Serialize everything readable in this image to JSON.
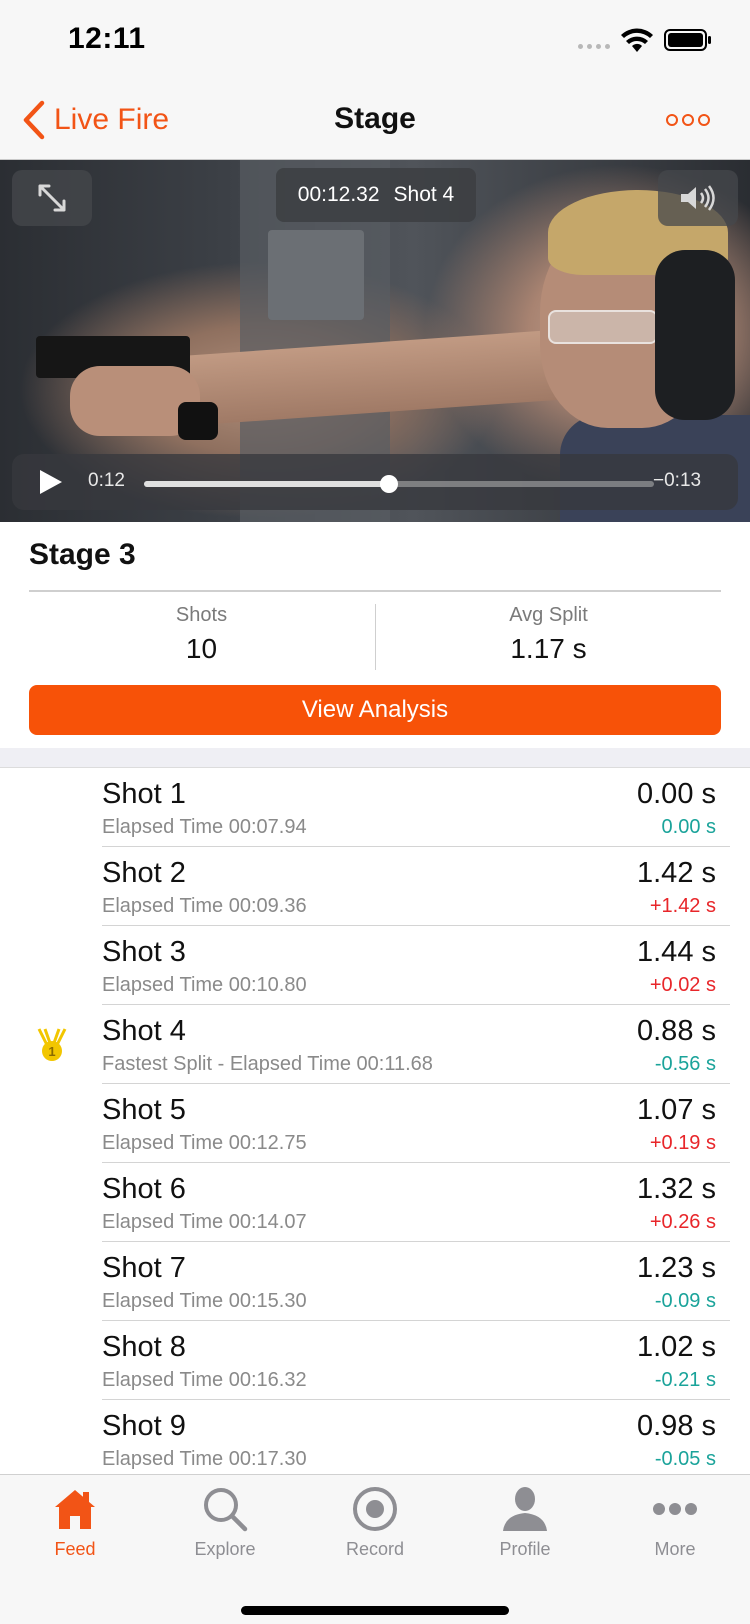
{
  "status_bar": {
    "time": "12:11"
  },
  "nav": {
    "back_label": "Live Fire",
    "title": "Stage"
  },
  "video": {
    "timestamp": "00:12.32",
    "shot_label": "Shot 4",
    "time_current": "0:12",
    "time_remaining": "−0:13",
    "progress_fraction": 0.48
  },
  "stage": {
    "title": "Stage 3",
    "shots_label": "Shots",
    "shots_value": "10",
    "avg_split_label": "Avg Split",
    "avg_split_value": "1.17 s",
    "analysis_button": "View Analysis"
  },
  "shots": [
    {
      "name": "Shot 1",
      "subtitle": "Elapsed Time 00:07.94",
      "split": "0.00 s",
      "delta": "0.00 s",
      "delta_color": "#1aa39a",
      "medal": false
    },
    {
      "name": "Shot 2",
      "subtitle": "Elapsed Time 00:09.36",
      "split": "1.42 s",
      "delta": "+1.42 s",
      "delta_color": "#e8262a",
      "medal": false
    },
    {
      "name": "Shot 3",
      "subtitle": "Elapsed Time 00:10.80",
      "split": "1.44 s",
      "delta": "+0.02 s",
      "delta_color": "#e8262a",
      "medal": false
    },
    {
      "name": "Shot 4",
      "subtitle": "Fastest Split - Elapsed Time 00:11.68",
      "split": "0.88 s",
      "delta": "-0.56 s",
      "delta_color": "#1aa39a",
      "medal": true
    },
    {
      "name": "Shot 5",
      "subtitle": "Elapsed Time 00:12.75",
      "split": "1.07 s",
      "delta": "+0.19 s",
      "delta_color": "#e8262a",
      "medal": false
    },
    {
      "name": "Shot 6",
      "subtitle": "Elapsed Time 00:14.07",
      "split": "1.32 s",
      "delta": "+0.26 s",
      "delta_color": "#e8262a",
      "medal": false
    },
    {
      "name": "Shot 7",
      "subtitle": "Elapsed Time 00:15.30",
      "split": "1.23 s",
      "delta": "-0.09 s",
      "delta_color": "#1aa39a",
      "medal": false
    },
    {
      "name": "Shot 8",
      "subtitle": "Elapsed Time 00:16.32",
      "split": "1.02 s",
      "delta": "-0.21 s",
      "delta_color": "#1aa39a",
      "medal": false
    },
    {
      "name": "Shot 9",
      "subtitle": "Elapsed Time 00:17.30",
      "split": "0.98 s",
      "delta": "-0.05 s",
      "delta_color": "#1aa39a",
      "medal": false
    }
  ],
  "tabs": [
    {
      "label": "Feed",
      "icon": "home-icon",
      "active": true
    },
    {
      "label": "Explore",
      "icon": "search-icon",
      "active": false
    },
    {
      "label": "Record",
      "icon": "record-icon",
      "active": false
    },
    {
      "label": "Profile",
      "icon": "person-icon",
      "active": false
    },
    {
      "label": "More",
      "icon": "more-dots-icon",
      "active": false
    }
  ],
  "colors": {
    "accent": "#f25416",
    "button": "#f75208",
    "positive": "#1aa39a",
    "negative": "#e8262a",
    "inactive": "#8e8e93",
    "medal": "#f2c600"
  }
}
